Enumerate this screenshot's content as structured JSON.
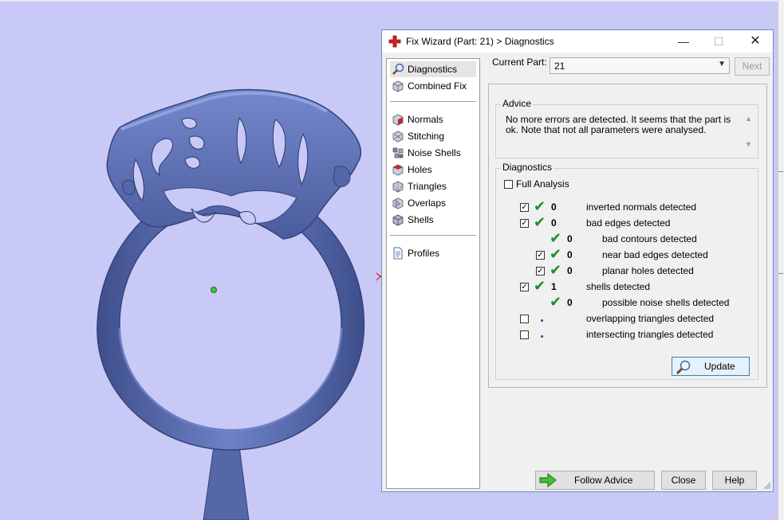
{
  "window": {
    "title": "Fix Wizard (Part: 21) > Diagnostics",
    "minimize_symbol": "—",
    "maximize_symbol": "☐",
    "close_symbol": "✕"
  },
  "nav": {
    "items": [
      {
        "label": "Diagnostics",
        "icon": "magnifier-icon",
        "selected": true
      },
      {
        "label": "Combined Fix",
        "icon": "cube-icon"
      },
      {
        "label": "Normals",
        "icon": "normals-cube-icon"
      },
      {
        "label": "Stitching",
        "icon": "stitching-cube-icon"
      },
      {
        "label": "Noise Shells",
        "icon": "noise-shells-icon"
      },
      {
        "label": "Holes",
        "icon": "holes-cube-icon"
      },
      {
        "label": "Triangles",
        "icon": "triangles-icon"
      },
      {
        "label": "Overlaps",
        "icon": "overlaps-icon"
      },
      {
        "label": "Shells",
        "icon": "shells-icon"
      },
      {
        "label": "Profiles",
        "icon": "document-icon"
      }
    ]
  },
  "current_part": {
    "label": "Current Part:",
    "value": "21",
    "next_label": "Next"
  },
  "advice": {
    "title": "Advice",
    "text": "No more errors are detected. It seems that the part is ok. Note that not all parameters were analysed."
  },
  "diagnostics": {
    "title": "Diagnostics",
    "full_analysis_label": "Full Analysis",
    "full_analysis_checked": false,
    "rows": [
      {
        "checkbox": true,
        "checked": true,
        "status": "ok",
        "count": "0",
        "label": "inverted normals detected",
        "indent": 0
      },
      {
        "checkbox": true,
        "checked": true,
        "status": "ok",
        "count": "0",
        "label": "bad edges detected",
        "indent": 0
      },
      {
        "checkbox": false,
        "status": "ok",
        "count": "0",
        "label": "bad contours detected",
        "indent": 1
      },
      {
        "checkbox": true,
        "checked": true,
        "status": "ok",
        "count": "0",
        "label": "near bad edges detected",
        "indent": 1
      },
      {
        "checkbox": true,
        "checked": true,
        "status": "ok",
        "count": "0",
        "label": "planar holes detected",
        "indent": 1
      },
      {
        "checkbox": true,
        "checked": true,
        "status": "ok",
        "count": "1",
        "label": "shells detected",
        "indent": 0
      },
      {
        "checkbox": false,
        "status": "ok",
        "count": "0",
        "label": "possible noise shells detected",
        "indent": 1
      },
      {
        "checkbox": true,
        "checked": false,
        "status": "pending",
        "count": "",
        "label": "overlapping triangles detected",
        "indent": 0
      },
      {
        "checkbox": true,
        "checked": false,
        "status": "pending",
        "count": "",
        "label": "intersecting triangles detected",
        "indent": 0
      }
    ],
    "update_label": "Update"
  },
  "buttons": {
    "follow_advice": "Follow Advice",
    "close": "Close",
    "help": "Help"
  },
  "colors": {
    "viewport_bg": "#c9c9f7",
    "model": "#5a6fb4",
    "ok_check": "#1c8f2c",
    "title_icon": "#d42020"
  }
}
